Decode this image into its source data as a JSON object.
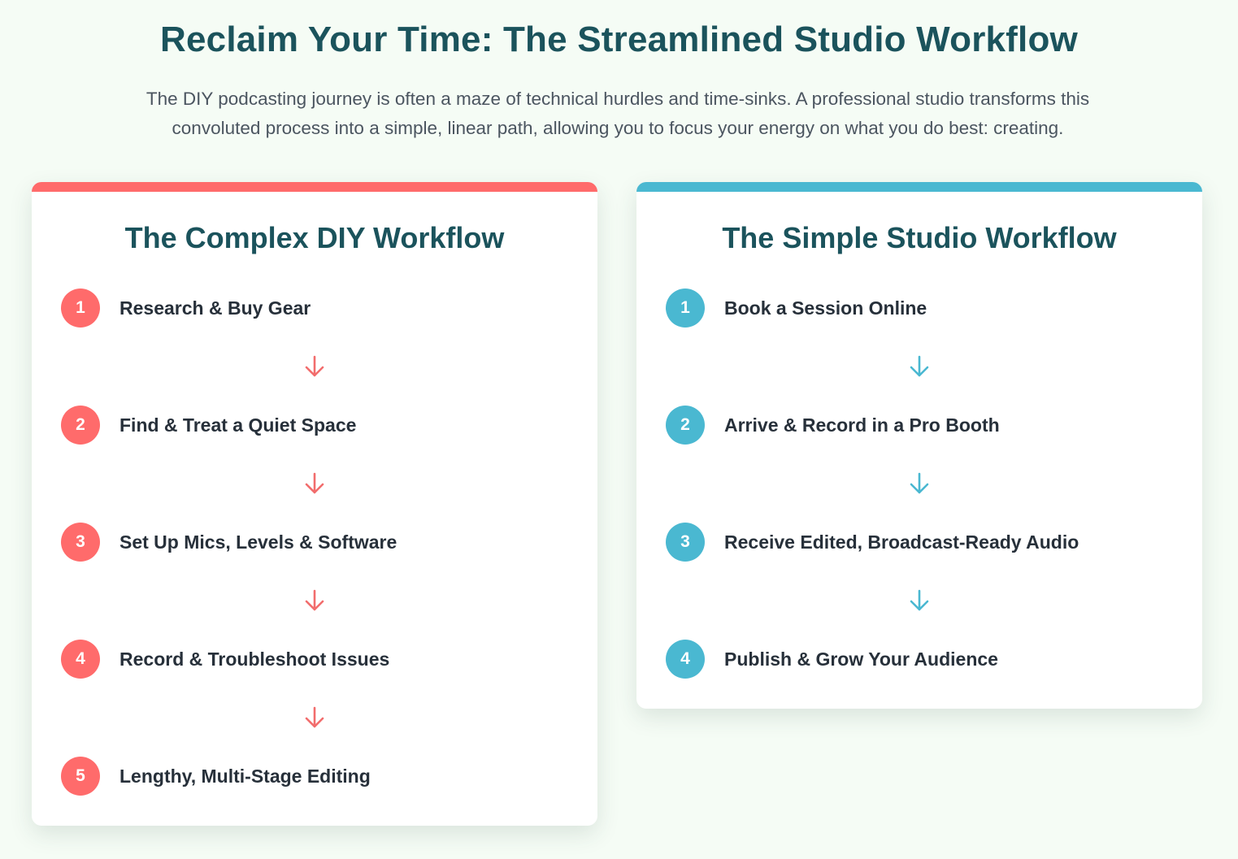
{
  "header": {
    "title": "Reclaim Your Time: The Streamlined Studio Workflow",
    "intro_line1": "The DIY podcasting journey is often a maze of technical hurdles and time-sinks. A professional studio transforms this",
    "intro_line2": "convoluted process into a simple, linear path, allowing you to focus your energy on what you do best: creating."
  },
  "diy_workflow": {
    "title": "The Complex DIY Workflow",
    "accent_color": "#ff6b6b",
    "steps": [
      {
        "number": "1",
        "label": "Research & Buy Gear"
      },
      {
        "number": "2",
        "label": "Find & Treat a Quiet Space"
      },
      {
        "number": "3",
        "label": "Set Up Mics, Levels & Software"
      },
      {
        "number": "4",
        "label": "Record & Troubleshoot Issues"
      },
      {
        "number": "5",
        "label": "Lengthy, Multi-Stage Editing"
      }
    ],
    "connector_icon": "arrow-down-icon"
  },
  "studio_workflow": {
    "title": "The Simple Studio Workflow",
    "accent_color": "#4ab8d1",
    "steps": [
      {
        "number": "1",
        "label": "Book a Session Online"
      },
      {
        "number": "2",
        "label": "Arrive & Record in a Pro Booth"
      },
      {
        "number": "3",
        "label": "Receive Edited, Broadcast-Ready Audio"
      },
      {
        "number": "4",
        "label": "Publish & Grow Your Audience"
      }
    ],
    "connector_icon": "arrow-down-icon"
  }
}
